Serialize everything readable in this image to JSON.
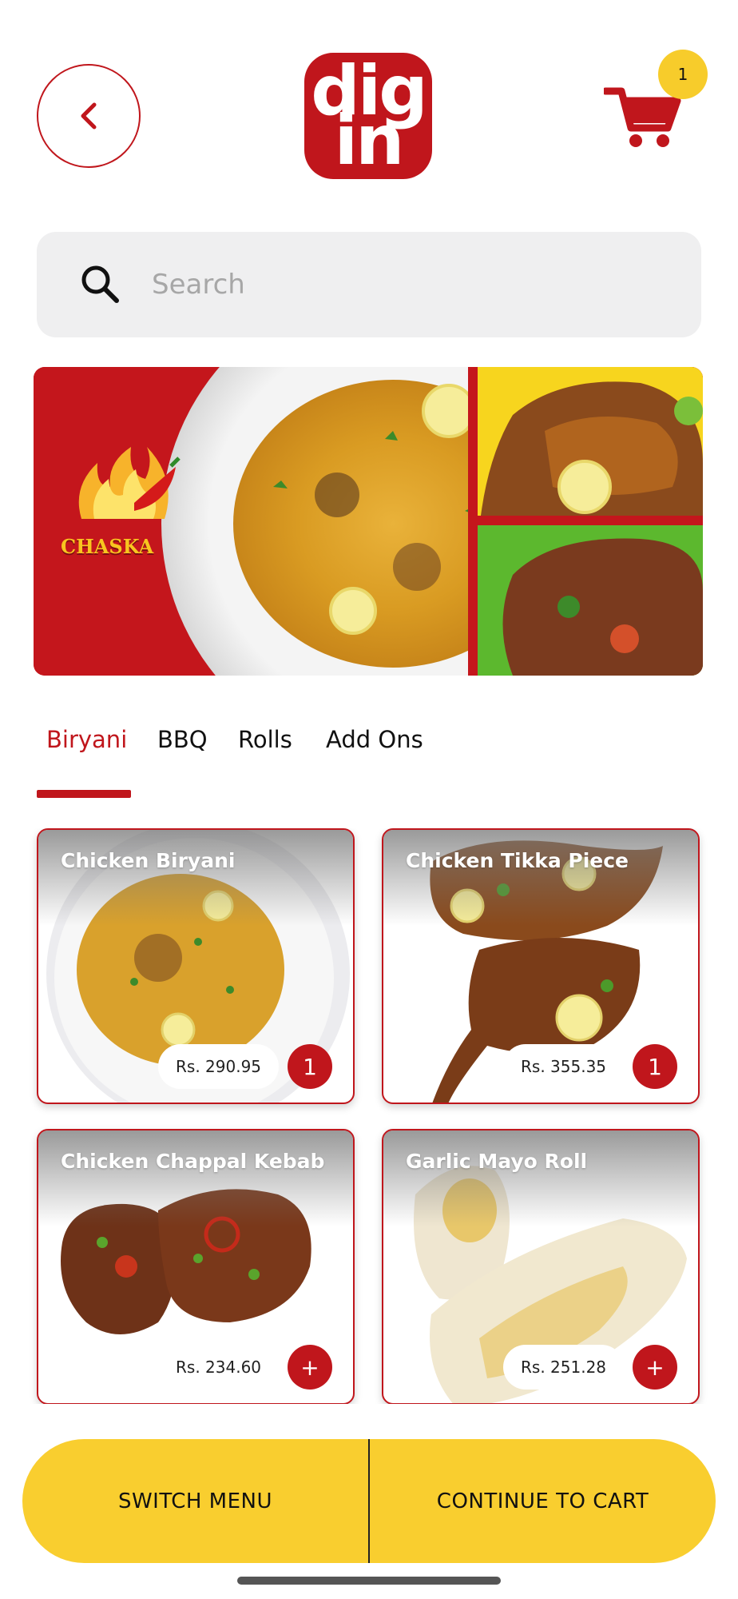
{
  "header": {
    "back_icon": "chevron-left-icon",
    "logo_text_line1": "dig",
    "logo_text_line2": "in",
    "cart_icon": "cart-icon",
    "cart_count": "1"
  },
  "search": {
    "placeholder": "Search",
    "icon": "search-icon"
  },
  "banner": {
    "brand": "CHASKA"
  },
  "tabs": [
    {
      "label": "Biryani",
      "active": true
    },
    {
      "label": "BBQ",
      "active": false
    },
    {
      "label": "Rolls",
      "active": false
    },
    {
      "label": "Add Ons",
      "active": false
    }
  ],
  "products": [
    {
      "name": "Chicken Biryani",
      "price": "Rs. 290.95",
      "quantity": "1"
    },
    {
      "name": "Chicken Tikka Piece",
      "price": "Rs. 355.35",
      "quantity": "1"
    },
    {
      "name": "Chicken Chappal Kebab",
      "price": "Rs. 234.60",
      "quantity": "+"
    },
    {
      "name": "Garlic Mayo Roll",
      "price": "Rs. 251.28",
      "quantity": "+"
    }
  ],
  "bottom_bar": {
    "switch_menu_label": "SWITCH MENU",
    "continue_label": "CONTINUE TO CART"
  },
  "colors": {
    "brand_red": "#c0161c",
    "accent_yellow": "#f9ce2f",
    "search_bg": "#efeff0"
  }
}
